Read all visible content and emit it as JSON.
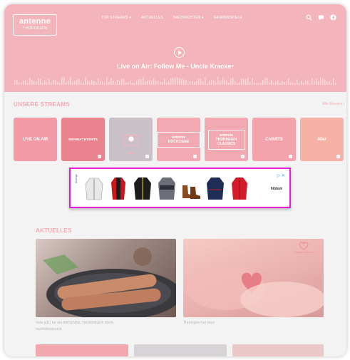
{
  "logo": {
    "line1": "antenne",
    "line2": "THÜRINGEN"
  },
  "nav": {
    "items": [
      "TOP STREAMS ▾",
      "AKTUELLES",
      "NACHRICHTEN ▾",
      "GEWINNSPIELE"
    ],
    "icons": [
      "search-icon",
      "message-icon",
      "facebook-icon"
    ]
  },
  "hero": {
    "now_playing": "Live on Air: Follow Me - Uncle Kracker"
  },
  "streams": {
    "heading": "UNSERE STREAMS",
    "more_label": "Alle Streams ›",
    "tiles": [
      {
        "label": "LIVE ON AIR",
        "color": "#f39aa6"
      },
      {
        "label": "WEIHNACHTSHITS",
        "color": "#e9848f"
      },
      {
        "label": "PARTY",
        "color": "#c9c0c8"
      },
      {
        "label": "antenne ROCKLIEBE",
        "color": "#f2a9b2"
      },
      {
        "label": "antenne THÜRINGEN CLASSICS",
        "color": "#f2a9b2"
      },
      {
        "label": "CHARTS",
        "color": "#f4a3ad"
      },
      {
        "label": "80er",
        "color": "#f7b2a7"
      }
    ]
  },
  "ad": {
    "choices": "▷ ✕",
    "brand": "hibbuk"
  },
  "news": {
    "heading": "AKTUELLES",
    "cards": [
      {
        "caption_line1": "Vote jetzt für die ANTENNE THÜRINGEN Weih-",
        "caption_line2": "nachtsbratwurst"
      },
      {
        "caption_line1": "Thüringen hat Herz",
        "caption_line2": ""
      }
    ],
    "badge_text": "Thüringen hat Herz"
  },
  "colors": {
    "brand": "#f3b4bc",
    "accent": "#f3a8b1",
    "ad_border": "#e61cd6"
  }
}
